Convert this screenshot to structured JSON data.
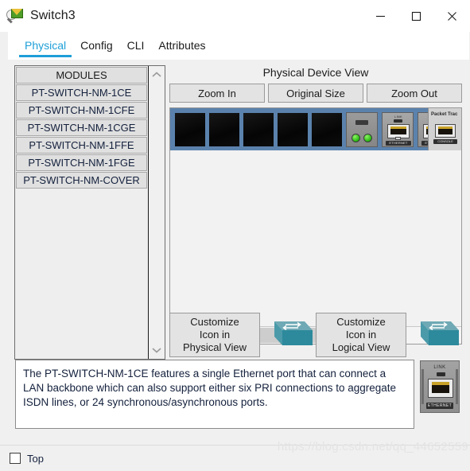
{
  "window": {
    "title": "Switch3",
    "icon": "packet-tracer-icon",
    "controls": {
      "minimize": "minimize-icon",
      "maximize": "maximize-icon",
      "close": "close-icon"
    }
  },
  "tabs": [
    {
      "label": "Physical",
      "active": true
    },
    {
      "label": "Config",
      "active": false
    },
    {
      "label": "CLI",
      "active": false
    },
    {
      "label": "Attributes",
      "active": false
    }
  ],
  "modules": {
    "header": "MODULES",
    "items": [
      "PT-SWITCH-NM-1CE",
      "PT-SWITCH-NM-1CFE",
      "PT-SWITCH-NM-1CGE",
      "PT-SWITCH-NM-1FFE",
      "PT-SWITCH-NM-1FGE",
      "PT-SWITCH-NM-COVER"
    ],
    "scroll_up": "chevron-up-icon",
    "scroll_down": "chevron-down-icon"
  },
  "device_view": {
    "title": "Physical Device View",
    "zoom_buttons": [
      "Zoom In",
      "Original Size",
      "Zoom Out"
    ],
    "chassis": {
      "empty_slots": 5,
      "nm_modules": 1,
      "ethernet_modules": 4,
      "ethernet_link_label": "LINK",
      "ethernet_port_label": "ETHERNET",
      "side_label": "Packet Trac",
      "side_port_label": "CONSOLE",
      "chassis_color": "#5b82ad"
    },
    "hscroll": {
      "left_arrow": "chevron-left-icon",
      "right_arrow": "chevron-right-icon",
      "thumb_percent": 75
    }
  },
  "customize": {
    "physical_button": [
      "Customize",
      "Icon in",
      "Physical View"
    ],
    "logical_button": [
      "Customize",
      "Icon in",
      "Logical View"
    ],
    "physical_icon": "switch-icon",
    "logical_icon": "switch-icon",
    "icon_color": "#2d8a9c"
  },
  "description": {
    "text": "The PT-SWITCH-NM-1CE features a single Ethernet port that can connect a LAN backbone which can also support either six PRI connections to aggregate ISDN lines, or 24 synchronous/asynchronous ports.",
    "preview_icon": "ethernet-module-icon",
    "preview_link_label": "LINK",
    "preview_port_label": "ETHERNET"
  },
  "bottom": {
    "checkbox_label": "Top",
    "checkbox_checked": false
  },
  "watermark": "https://blog.csdn.net/qq_44652559",
  "colors": {
    "accent": "#1e9fd8",
    "chassis": "#5b82ad",
    "switch_icon": "#2d8a9c",
    "window_bg": "#f0f0f0"
  }
}
